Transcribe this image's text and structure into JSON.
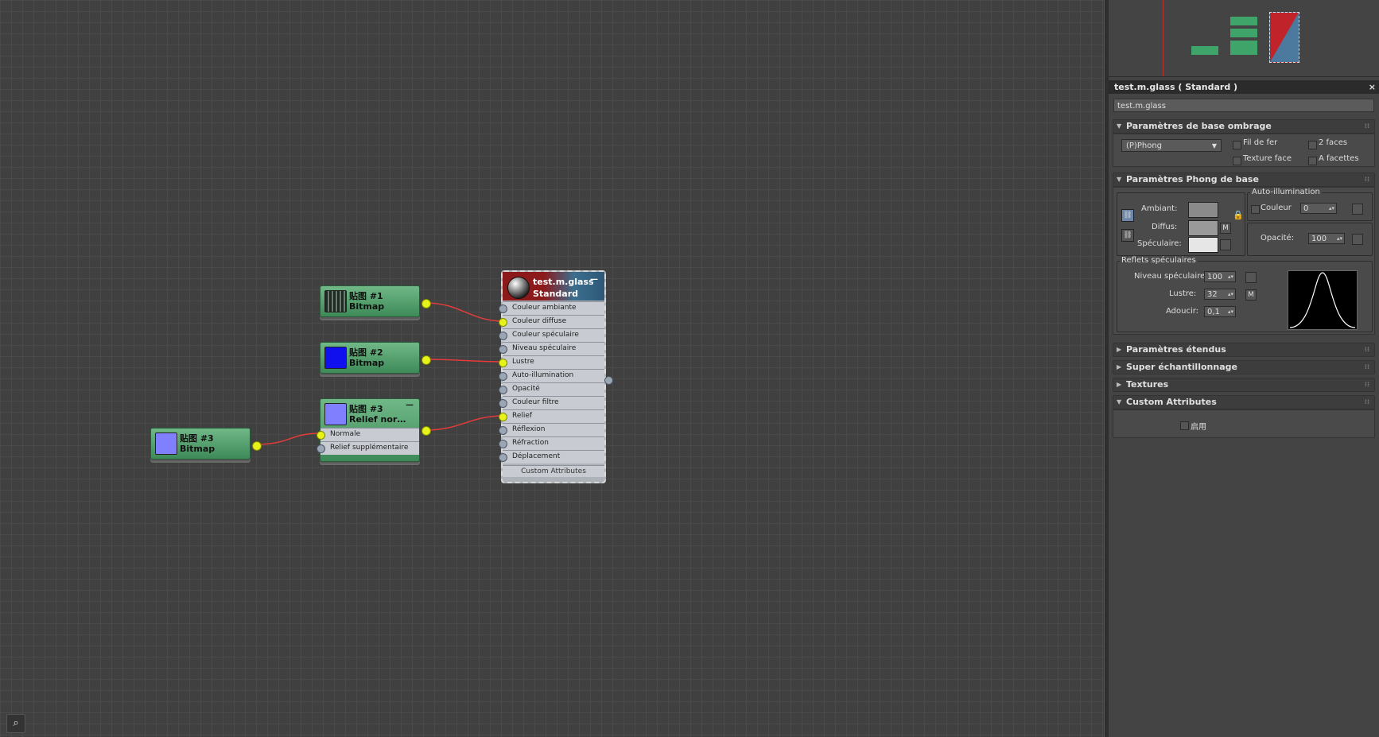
{
  "nodes": {
    "bitmap1": {
      "title": "贴图 #1",
      "type": "Bitmap"
    },
    "bitmap2": {
      "title": "贴图 #2",
      "type": "Bitmap"
    },
    "bitmap3": {
      "title": "贴图 #3",
      "type": "Bitmap"
    },
    "normal_bump": {
      "title": "贴图 #3",
      "type": "Relief nor…",
      "slots": [
        "Normale",
        "Relief supplémentaire"
      ]
    },
    "material": {
      "name": "test.m.glass",
      "type": "Standard",
      "slots": [
        "Couleur ambiante",
        "Couleur diffuse",
        "Couleur spéculaire",
        "Niveau spéculaire",
        "Lustre",
        "Auto-illumination",
        "Opacité",
        "Couleur filtre",
        "Relief",
        "Réflexion",
        "Réfraction",
        "Déplacement"
      ],
      "footer": "Custom Attributes"
    }
  },
  "colors": {
    "bitmap2_thumb": "#1010ee",
    "bitmap3_thumb": "#8080ff",
    "wire": "#e53b3b",
    "port_active": "#e6f21a",
    "node_green": "#4f9a68"
  },
  "panel": {
    "title": "test.m.glass  ( Standard )",
    "close": "×",
    "name_value": "test.m.glass",
    "rollouts": {
      "shading": {
        "title": "Paramètres de base ombrage",
        "shader": "(P)Phong",
        "wire": "Fil de fer",
        "two_sided": "2 faces",
        "face_map": "Texture face",
        "faceted": "A facettes"
      },
      "phong": {
        "title": "Paramètres Phong de base",
        "self_illum_group": "Auto-illumination",
        "ambient": "Ambiant:",
        "diffuse": "Diffus:",
        "specular": "Spéculaire:",
        "m": "M",
        "color_label": "Couleur",
        "color_value": "0",
        "opacity_label": "Opacité:",
        "opacity_value": "100",
        "highlights_group": "Reflets spéculaires",
        "spec_level_label": "Niveau spéculaire:",
        "spec_level_value": "100",
        "gloss_label": "Lustre:",
        "gloss_value": "32",
        "soften_label": "Adoucir:",
        "soften_value": "0,1"
      },
      "extended": {
        "title": "Paramètres étendus"
      },
      "supersampling": {
        "title": "Super échantillonnage"
      },
      "maps": {
        "title": "Textures"
      },
      "custom": {
        "title": "Custom Attributes",
        "enable": "启用"
      }
    }
  }
}
